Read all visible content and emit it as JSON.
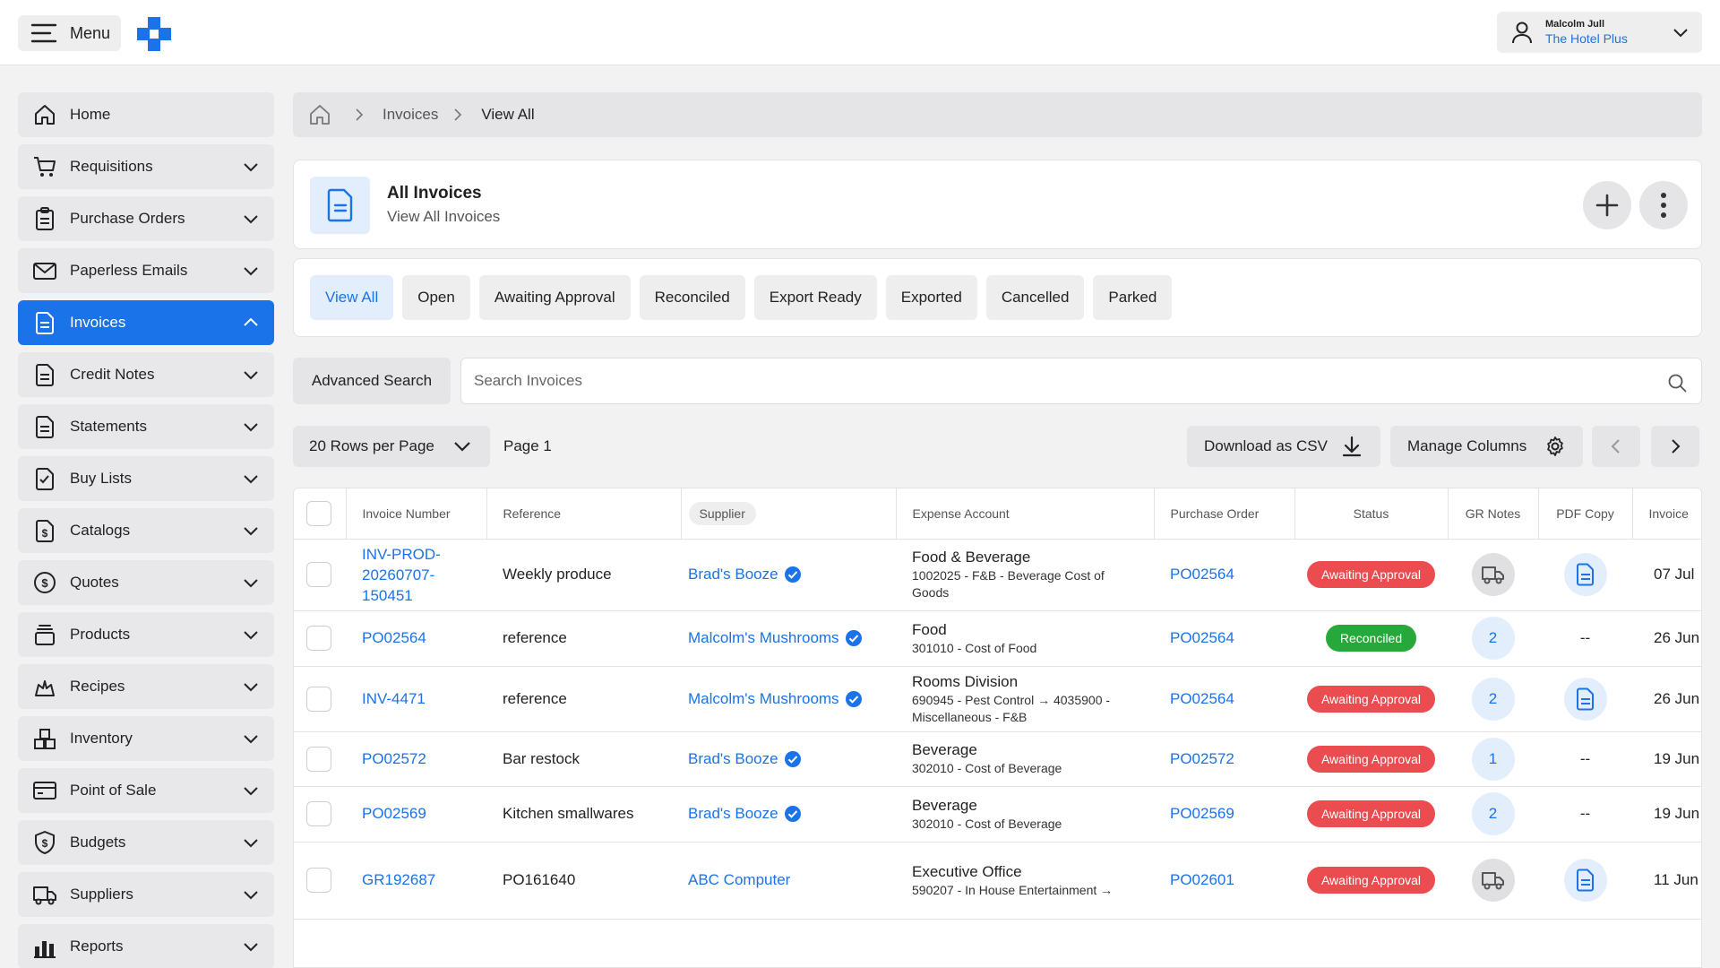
{
  "topbar": {
    "menu_label": "Menu",
    "user_name": "Malcolm Jull",
    "user_org": "The Hotel Plus"
  },
  "sidebar": {
    "items": [
      {
        "label": "Home",
        "icon": "home-icon"
      },
      {
        "label": "Requisitions",
        "icon": "cart-icon"
      },
      {
        "label": "Purchase Orders",
        "icon": "clipboard-icon"
      },
      {
        "label": "Paperless Emails",
        "icon": "mail-icon"
      },
      {
        "label": "Invoices",
        "icon": "document-icon",
        "active": true
      },
      {
        "label": "Credit Notes",
        "icon": "document-icon"
      },
      {
        "label": "Statements",
        "icon": "document-icon"
      },
      {
        "label": "Buy Lists",
        "icon": "checklist-icon"
      },
      {
        "label": "Catalogs",
        "icon": "dollar-document-icon"
      },
      {
        "label": "Quotes",
        "icon": "dollar-circle-icon"
      },
      {
        "label": "Products",
        "icon": "stack-icon"
      },
      {
        "label": "Recipes",
        "icon": "chef-hat-icon"
      },
      {
        "label": "Inventory",
        "icon": "boxes-icon"
      },
      {
        "label": "Point of Sale",
        "icon": "card-icon"
      },
      {
        "label": "Budgets",
        "icon": "shield-dollar-icon"
      },
      {
        "label": "Suppliers",
        "icon": "truck-icon"
      },
      {
        "label": "Reports",
        "icon": "bar-chart-icon"
      }
    ]
  },
  "breadcrumb": {
    "items": [
      "Invoices",
      "View All"
    ]
  },
  "header": {
    "title": "All Invoices",
    "subtitle": "View All Invoices"
  },
  "tabs": [
    "View All",
    "Open",
    "Awaiting Approval",
    "Reconciled",
    "Export Ready",
    "Exported",
    "Cancelled",
    "Parked"
  ],
  "search": {
    "advanced_label": "Advanced Search",
    "placeholder": "Search Invoices"
  },
  "toolbar": {
    "rows_label": "20 Rows per Page",
    "page_label": "Page 1",
    "csv_label": "Download as CSV",
    "columns_label": "Manage Columns"
  },
  "table": {
    "columns": [
      "Invoice Number",
      "Reference",
      "Supplier",
      "Expense Account",
      "Purchase Order",
      "Status",
      "GR Notes",
      "PDF Copy",
      "Invoice"
    ],
    "rows": [
      {
        "invoice": "INV-PROD-20260707-150451",
        "invoice_lines": [
          "INV-PROD-",
          "20260707-",
          "150451"
        ],
        "reference": "Weekly produce",
        "supplier": "Brad's Booze",
        "exp_main": "Food & Beverage",
        "exp_sub": "1002025 - F&B - Beverage Cost of Goods",
        "po": "PO02564",
        "status": "Awaiting Approval",
        "status_type": "await",
        "gr": "truck",
        "pdf": "doc",
        "date": "07 Jul"
      },
      {
        "invoice": "PO02564",
        "reference": "reference",
        "supplier": "Malcolm's Mushrooms",
        "exp_main": "Food",
        "exp_sub": "301010 - Cost of Food",
        "po": "PO02564",
        "status": "Reconciled",
        "status_type": "recon",
        "gr": "2",
        "pdf": "--",
        "date": "26 Jun"
      },
      {
        "invoice": "INV-4471",
        "reference": "reference",
        "supplier": "Malcolm's Mushrooms",
        "exp_main": "Rooms Division",
        "exp_sub": "690945 - Pest Control → 4035900 - Miscellaneous - F&B",
        "po": "PO02564",
        "status": "Awaiting Approval",
        "status_type": "await",
        "gr": "2",
        "pdf": "doc",
        "date": "26 Jun"
      },
      {
        "invoice": "PO02572",
        "reference": "Bar restock",
        "supplier": "Brad's Booze",
        "exp_main": "Beverage",
        "exp_sub": "302010 - Cost of Beverage",
        "po": "PO02572",
        "status": "Awaiting Approval",
        "status_type": "await",
        "gr": "1",
        "pdf": "--",
        "date": "19 Jun"
      },
      {
        "invoice": "PO02569",
        "reference": "Kitchen smallwares",
        "supplier": "Brad's Booze",
        "exp_main": "Beverage",
        "exp_sub": "302010 - Cost of Beverage",
        "po": "PO02569",
        "status": "Awaiting Approval",
        "status_type": "await",
        "gr": "2",
        "pdf": "--",
        "date": "19 Jun"
      },
      {
        "invoice": "GR192687",
        "reference": "PO161640",
        "supplier": "ABC Computer",
        "exp_main": "Executive Office",
        "exp_sub": "590207 - In House Entertainment →",
        "po": "PO02601",
        "status": "Awaiting Approval",
        "status_type": "await",
        "gr": "truck",
        "pdf": "doc",
        "date": "11 Jun"
      }
    ]
  },
  "colors": {
    "accent": "#1a73e8",
    "await": "#ea4c4f",
    "recon": "#27a83a"
  }
}
